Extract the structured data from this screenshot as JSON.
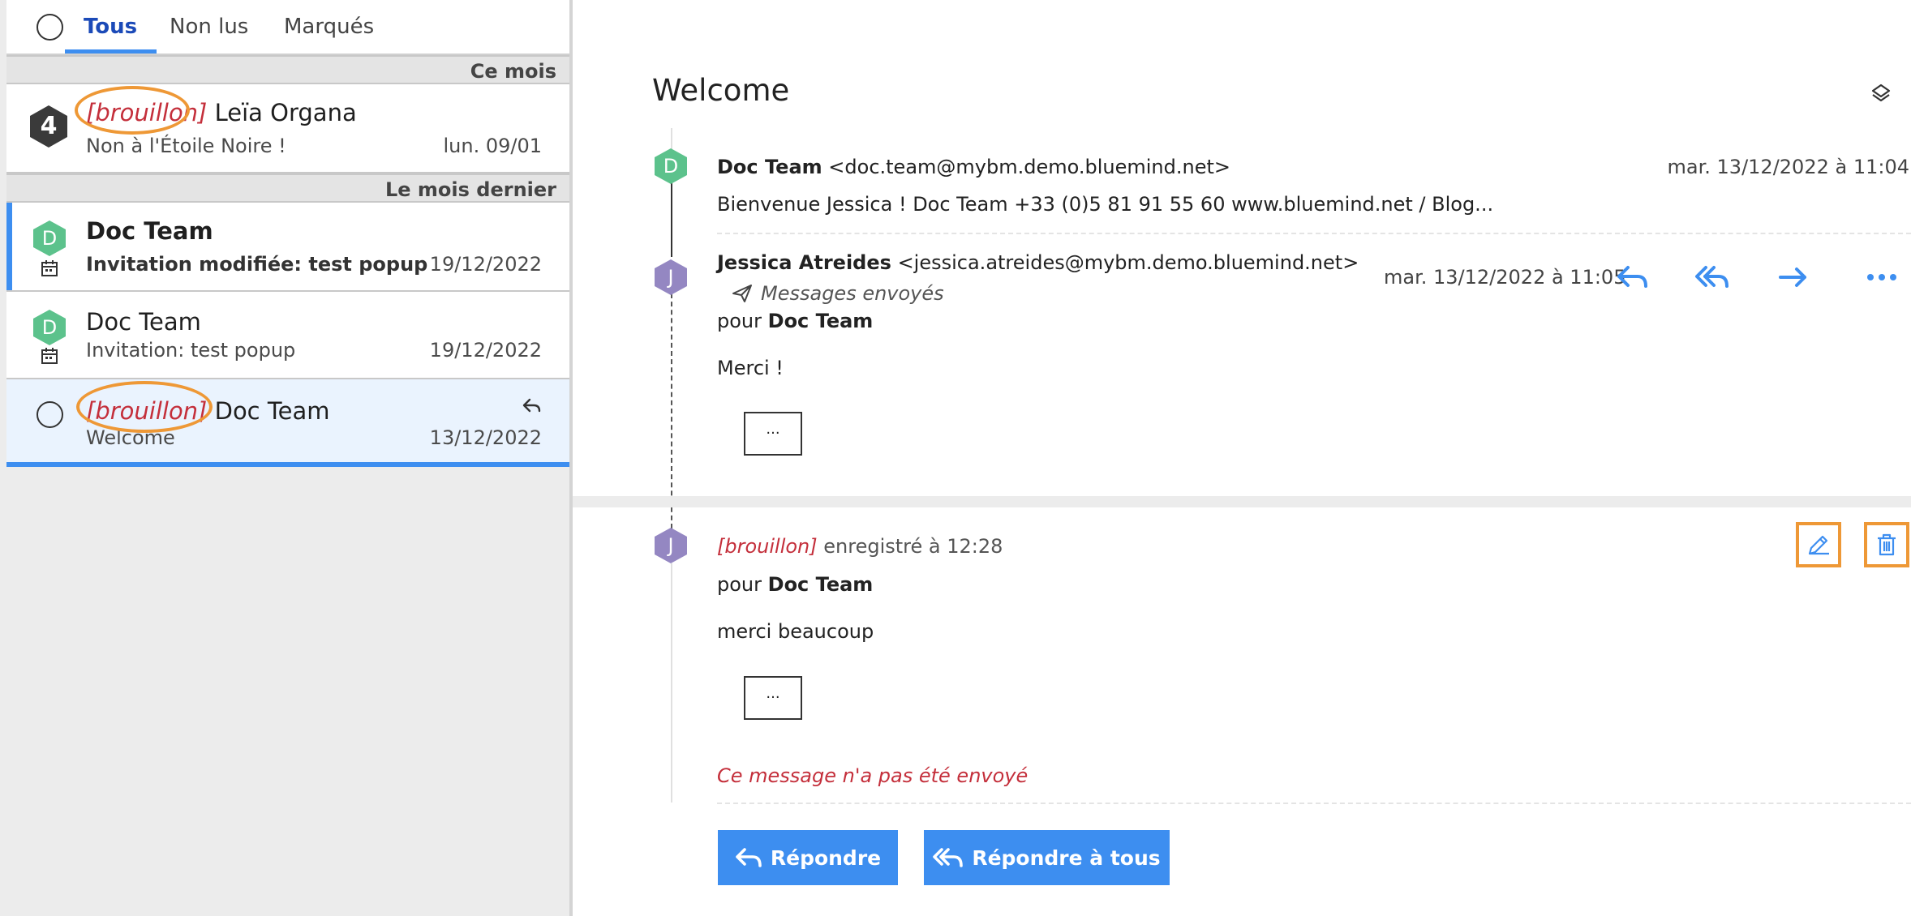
{
  "filters": {
    "tabs": [
      "Tous",
      "Non lus",
      "Marqués"
    ],
    "active": "Tous"
  },
  "groups": {
    "this_month": "Ce mois",
    "last_month": "Le mois dernier"
  },
  "messages": [
    {
      "draft_tag": "[brouillon]",
      "name": "Leïa Organa",
      "subject": "Non à l'Étoile Noire !",
      "date": "lun. 09/01",
      "avatar": "4"
    },
    {
      "name": "Doc Team",
      "subject": "Invitation modifiée: test popup",
      "date": "19/12/2022",
      "avatar": "D",
      "unread": true
    },
    {
      "name": "Doc Team",
      "subject": "Invitation: test popup",
      "date": "19/12/2022",
      "avatar": "D"
    },
    {
      "draft_tag": "[brouillon]",
      "name": "Doc Team",
      "subject": "Welcome",
      "date": "13/12/2022",
      "selected": true
    }
  ],
  "conversation": {
    "subject": "Welcome",
    "msg1": {
      "avatar": "D",
      "sender_name": "Doc Team",
      "sender_email": "<doc.team@mybm.demo.bluemind.net>",
      "date": "mar. 13/12/2022 à 11:04",
      "preview": "Bienvenue Jessica ! Doc Team +33 (0)5 81 91 55 60 www.bluemind.net / Blog..."
    },
    "msg2": {
      "avatar": "J",
      "sender_name": "Jessica Atreides",
      "sender_email": "<jessica.atreides@mybm.demo.bluemind.net>",
      "folder": "Messages envoyés",
      "to_prefix": "pour",
      "to": "Doc Team",
      "date": "mar. 13/12/2022 à 11:05",
      "body": "Merci !",
      "ellipsis": "..."
    },
    "draft": {
      "avatar": "J",
      "tag": "[brouillon]",
      "saved": "enregistré à 12:28",
      "to_prefix": "pour",
      "to": "Doc Team",
      "body": "merci beaucoup",
      "ellipsis": "...",
      "not_sent": "Ce message n'a pas été envoyé"
    },
    "buttons": {
      "reply": "Répondre",
      "reply_all": "Répondre à tous"
    }
  },
  "colors": {
    "accent": "#3d8ef0",
    "draft_red": "#c42f3b",
    "highlight": "#ee9836",
    "avatar_green": "#5cc28c",
    "avatar_purple": "#9487c2"
  }
}
